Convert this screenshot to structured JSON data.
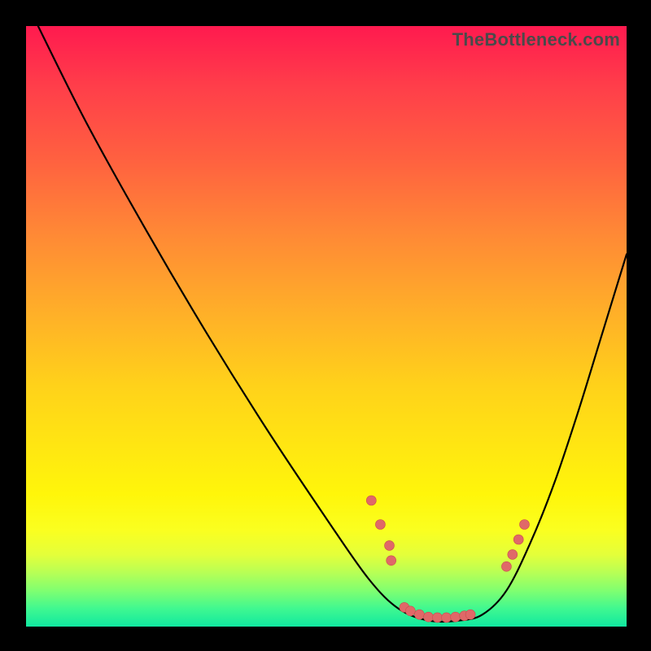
{
  "watermark": "TheBottleneck.com",
  "colors": {
    "curve": "#000000",
    "dot_fill": "#e06868",
    "dot_stroke": "#c94d4d"
  },
  "chart_data": {
    "type": "line",
    "title": "",
    "xlabel": "",
    "ylabel": "",
    "xlim": [
      0,
      100
    ],
    "ylim": [
      0,
      100
    ],
    "series": [
      {
        "name": "bottleneck-curve",
        "x": [
          2,
          10,
          20,
          30,
          40,
          50,
          57,
          62,
          67,
          72,
          76,
          80,
          84,
          88,
          92,
          96,
          100
        ],
        "y": [
          100,
          84,
          66,
          49,
          33,
          18,
          8,
          3,
          1,
          1,
          2,
          6,
          14,
          24,
          36,
          49,
          62
        ]
      }
    ],
    "markers": {
      "name": "highlight-points",
      "x": [
        57.5,
        59.0,
        60.5,
        60.8,
        63.0,
        64.0,
        65.5,
        67.0,
        68.5,
        70.0,
        71.5,
        73.0,
        74.0,
        80.0,
        81.0,
        82.0,
        83.0
      ],
      "y": [
        21.0,
        17.0,
        13.5,
        11.0,
        3.2,
        2.6,
        2.0,
        1.6,
        1.5,
        1.5,
        1.6,
        1.8,
        2.0,
        10.0,
        12.0,
        14.5,
        17.0
      ]
    }
  }
}
